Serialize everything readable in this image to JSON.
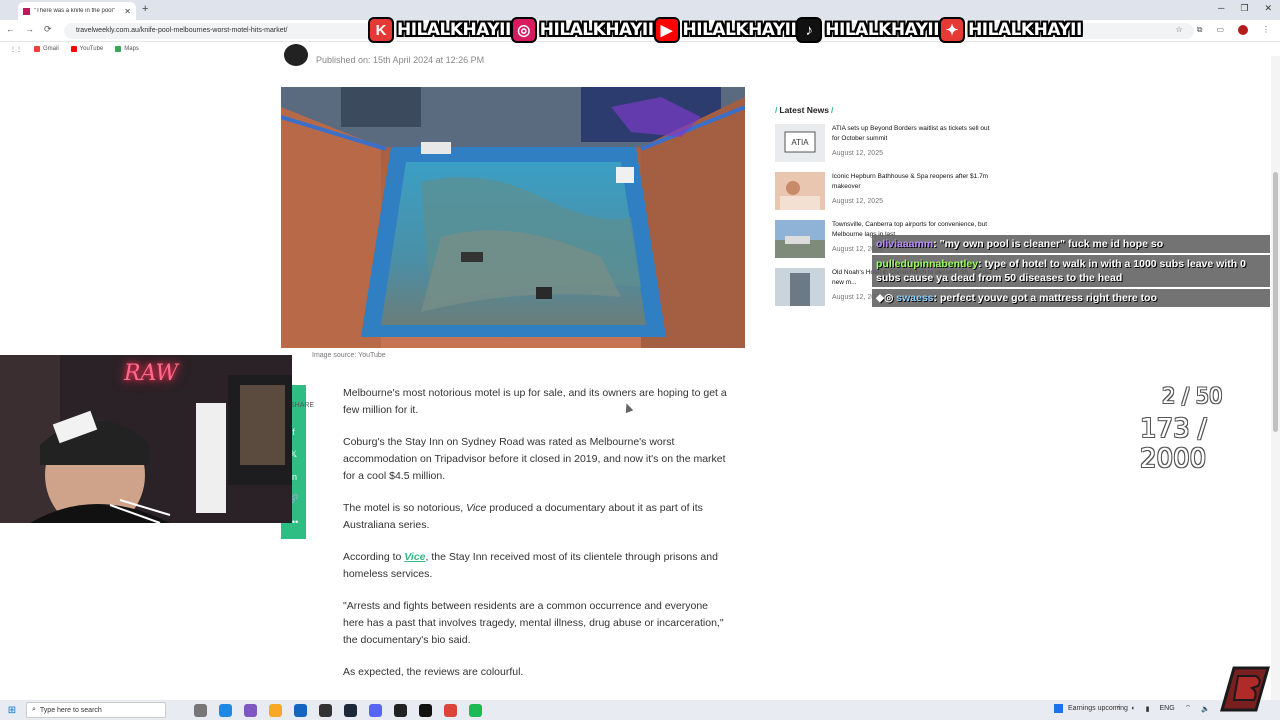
{
  "browser": {
    "tab_title": "\"There was a knife in the pool\"",
    "tab_close": "✕",
    "new_tab": "+",
    "window_controls": [
      "─",
      "❐",
      "✕"
    ],
    "nav": [
      "←",
      "→",
      "⟳"
    ],
    "url": "travelweekly.com.au/knife-pool-melbournes-worst-motel-hits-market/",
    "bookmarks": [
      {
        "label": "Gmail",
        "color": "#ea4335"
      },
      {
        "label": "YouTube",
        "color": "#ff0000"
      },
      {
        "label": "Maps",
        "color": "#34a853"
      }
    ]
  },
  "socials": [
    {
      "icon": "kick-icon",
      "glyph": "K",
      "color": "#e53935",
      "handle": "HILALKHAYII"
    },
    {
      "icon": "instagram-icon",
      "glyph": "◎",
      "color": "#d81b60",
      "handle": "HILALKHAYII"
    },
    {
      "icon": "youtube-icon",
      "glyph": "▶",
      "color": "#ff0000",
      "handle": "HILALKHAYII"
    },
    {
      "icon": "tiktok-icon",
      "glyph": "♪",
      "color": "#111111",
      "handle": "HILALKHAYII"
    },
    {
      "icon": "twitter-icon",
      "glyph": "✦",
      "color": "#e53935",
      "handle": "HILALKHAYII"
    }
  ],
  "article": {
    "published": "Published on: 15th April 2024 at 12:26 PM",
    "image_caption": "Image source: YouTube",
    "share_label": "SHARE",
    "paragraphs": {
      "p1": "Melbourne's most notorious motel is up for sale, and its owners are hoping to get a few million for it.",
      "p2": "Coburg's the Stay Inn on Sydney Road was rated as Melbourne's worst accommodation on Tripadvisor before it closed in 2019, and now it's on the market for a cool $4.5 million.",
      "p3a": "The motel is so notorious, ",
      "p3em": "Vice",
      "p3b": " produced a documentary about it as part of its Australiana series.",
      "p4a": "According to ",
      "p4link": "Vice",
      "p4b": ", the Stay Inn received most of its clientele through prisons and homeless services.",
      "p5": "\"Arrests and fights between residents are a common occurrence and everyone here has a past that involves tragedy, mental illness, drug abuse or incarceration,\" the documentary's bio said.",
      "p6": "As expected, the reviews are colourful."
    }
  },
  "sidebar": {
    "title": "Latest News",
    "items": [
      {
        "title": "ATIA sets up Beyond Borders waitlist as tickets sell out for October summit",
        "date": "August 12, 2025"
      },
      {
        "title": "Iconic Hepburn Bathhouse & Spa reopens after $1.7m makeover",
        "date": "August 12, 2025"
      },
      {
        "title": "Townsville, Canberra top airports for convenience, but Melbourne lags in last",
        "date": "August 12, 2025"
      },
      {
        "title": "Old Noah's Hotel in Christchurch to become Sh... under new m...",
        "date": "August 12, 2025"
      }
    ]
  },
  "chat": [
    {
      "user": "oliviaaamm",
      "user_color": "#b98cff",
      "message": ": \"my own pool is cleaner\" fuck me id hope so"
    },
    {
      "user": "pulledupinnabentley",
      "user_color": "#9cff5b",
      "message": ": type of hotel to walk in with a 1000 subs leave with 0 subs cause ya dead from 50 diseases to the head"
    },
    {
      "user": "swaess",
      "user_color": "#8fd3ff",
      "message": ": perfect youve got a mattress right there too"
    }
  ],
  "counters": {
    "goal_small": "2 / 50",
    "goal_large": "173 / 2000"
  },
  "webcam": {
    "neon_sign": "RAW"
  },
  "taskbar": {
    "search_placeholder": "Type here to search",
    "widget": "Earnings upcoming",
    "language": "ENG"
  },
  "colors": {
    "accent": "#2fbd84"
  }
}
